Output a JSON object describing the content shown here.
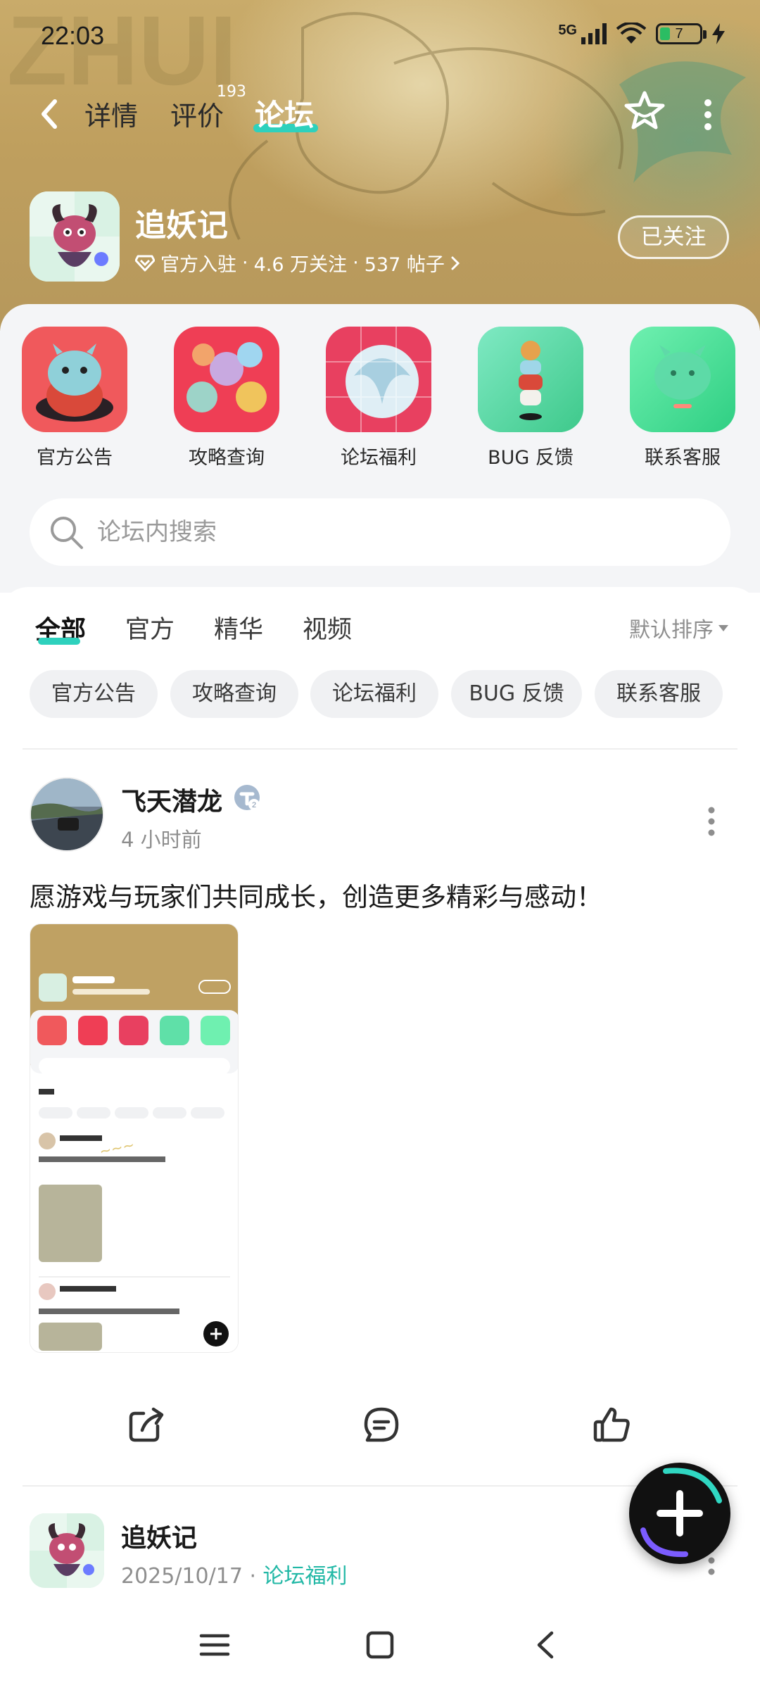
{
  "status_bar": {
    "time": "22:03",
    "network": "5G",
    "battery_level": "7"
  },
  "nav": {
    "tabs": [
      {
        "label": "详情"
      },
      {
        "label": "评价",
        "badge": "193"
      },
      {
        "label": "论坛"
      }
    ],
    "active_tab": "论坛"
  },
  "game": {
    "name": "追妖记",
    "meta_official": "官方入驻",
    "meta_followers": "4.6 万关注",
    "meta_posts": "537 帖子",
    "follow_label": "已关注"
  },
  "quick_links": [
    {
      "label": "官方公告"
    },
    {
      "label": "攻略查询"
    },
    {
      "label": "论坛福利"
    },
    {
      "label": "BUG 反馈"
    },
    {
      "label": "联系客服"
    }
  ],
  "search": {
    "placeholder": "论坛内搜索"
  },
  "feed_tabs": [
    {
      "label": "全部"
    },
    {
      "label": "官方"
    },
    {
      "label": "精华"
    },
    {
      "label": "视频"
    }
  ],
  "sort_label": "默认排序",
  "chips": [
    {
      "label": "官方公告"
    },
    {
      "label": "攻略查询"
    },
    {
      "label": "论坛福利"
    },
    {
      "label": "BUG 反馈"
    },
    {
      "label": "联系客服"
    }
  ],
  "posts": [
    {
      "user": "飞天潜龙",
      "time": "4 小时前",
      "text": "愿游戏与玩家们共同成长，创造更多精彩与感动！"
    },
    {
      "user": "追妖记",
      "date": "2025/10/17",
      "category": "论坛福利"
    }
  ],
  "colors": {
    "accent": "#2ed1bd",
    "link": "#22b8a6",
    "hero": "#bf9f5e"
  }
}
